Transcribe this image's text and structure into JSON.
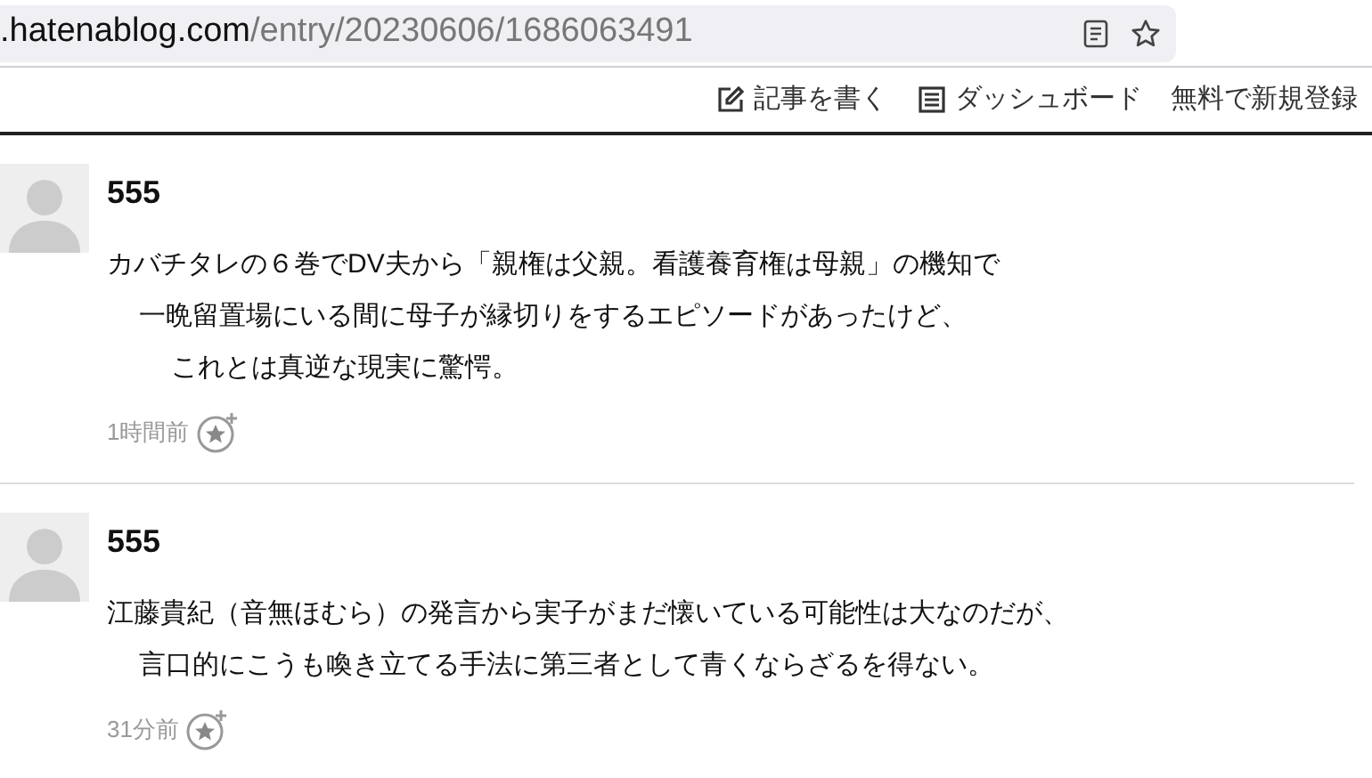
{
  "address_bar": {
    "domain": ".hatenablog.com",
    "path": "/entry/20230606/1686063491"
  },
  "header_links": [
    {
      "kind": "write",
      "label": "記事を書く"
    },
    {
      "kind": "dashboard",
      "label": "ダッシュボード"
    },
    {
      "kind": "plain",
      "label": "無料で新規登録"
    }
  ],
  "comments": [
    {
      "name": "555",
      "lines": [
        "カバチタレの６巻でDV夫から「親権は父親。看護養育権は母親」の機知で",
        "一晩留置場にいる間に母子が縁切りをするエピソードがあったけど、",
        "これとは真逆な現実に驚愕。"
      ],
      "time": "1時間前"
    },
    {
      "name": "555",
      "lines": [
        "江藤貴紀（音無ほむら）の発言から実子がまだ懐いている可能性は大なのだが、",
        "言口的にこうも喚き立てる手法に第三者として青くならざるを得ない。"
      ],
      "time": "31分前"
    }
  ]
}
